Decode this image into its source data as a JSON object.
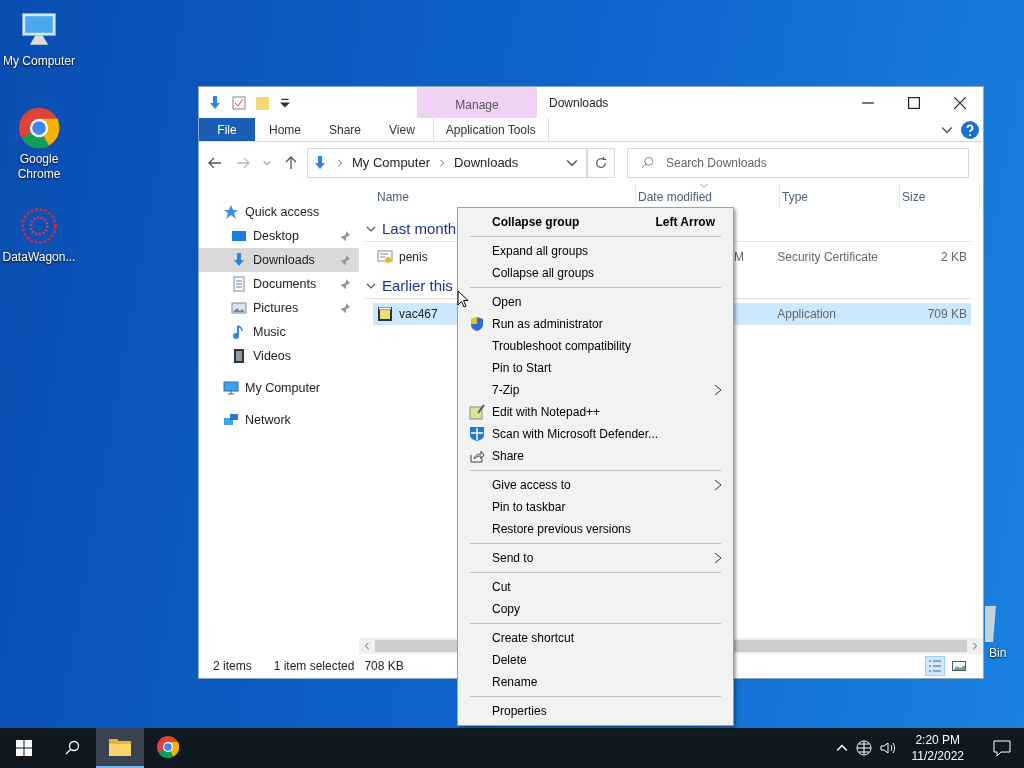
{
  "desktop_icons": [
    {
      "label": "My Computer",
      "kind": "computer"
    },
    {
      "label": "Google\nChrome",
      "kind": "browser"
    },
    {
      "label": "DataWagon...",
      "kind": "app"
    }
  ],
  "recycle_bin": {
    "label": "Bin"
  },
  "window": {
    "title": "Downloads",
    "context_tab": "Manage",
    "ribbon_tabs": [
      {
        "label": "File",
        "selected": false,
        "kind": "file"
      },
      {
        "label": "Home",
        "selected": false,
        "kind": "tab"
      },
      {
        "label": "Share",
        "selected": false,
        "kind": "tab"
      },
      {
        "label": "View",
        "selected": false,
        "kind": "tab"
      },
      {
        "label": "Application Tools",
        "selected": false,
        "kind": "context"
      }
    ],
    "address": {
      "crumbs": [
        "My Computer",
        "Downloads"
      ]
    },
    "search": {
      "placeholder": "Search Downloads"
    },
    "nav": [
      {
        "label": "Quick access",
        "kind": "star",
        "selected": false,
        "children": [
          {
            "label": "Desktop",
            "kind": "desktop",
            "selected": false,
            "pinned": true
          },
          {
            "label": "Downloads",
            "kind": "downloads",
            "selected": true,
            "pinned": true
          },
          {
            "label": "Documents",
            "kind": "documents",
            "selected": false,
            "pinned": true
          },
          {
            "label": "Pictures",
            "kind": "pictures",
            "selected": false,
            "pinned": true
          },
          {
            "label": "Music",
            "kind": "music",
            "selected": false,
            "pinned": false
          },
          {
            "label": "Videos",
            "kind": "videos",
            "selected": false,
            "pinned": false
          }
        ]
      },
      {
        "label": "My Computer",
        "kind": "computer",
        "selected": false
      },
      {
        "label": "Network",
        "kind": "network",
        "selected": false
      }
    ],
    "columns": [
      {
        "label": "Name",
        "sorted": false
      },
      {
        "label": "Date modified",
        "sorted": true
      },
      {
        "label": "Type",
        "sorted": false
      },
      {
        "label": "Size",
        "sorted": false
      }
    ],
    "groups": [
      {
        "label": "Last month",
        "expanded": true,
        "files": [
          {
            "name": "penis",
            "kind": "certificate",
            "date": "M",
            "type": "Security Certificate",
            "size": "2 KB",
            "selected": false
          }
        ]
      },
      {
        "label": "Earlier this",
        "expanded": true,
        "files": [
          {
            "name": "vac467",
            "kind": "application",
            "type": "Application",
            "size": "709 KB",
            "selected": true
          }
        ]
      }
    ],
    "status_bar": {
      "count": "2 items",
      "selection": "1 item selected",
      "size": "708 KB"
    },
    "views": [
      {
        "kind": "details",
        "selected": true
      },
      {
        "kind": "large",
        "selected": false
      }
    ]
  },
  "context_menu": {
    "groups": [
      [
        {
          "label": "Collapse group",
          "shortcut": "Left Arrow",
          "default": true
        }
      ],
      [
        {
          "label": "Expand all groups"
        },
        {
          "label": "Collapse all groups"
        }
      ],
      [
        {
          "label": "Open"
        },
        {
          "label": "Run as administrator"
        },
        {
          "label": "Troubleshoot compatibility"
        },
        {
          "label": "Pin to Start"
        },
        {
          "label": "7-Zip",
          "submenu": true
        },
        {
          "label": "Edit with Notepad++"
        },
        {
          "label": "Scan with Microsoft Defender..."
        },
        {
          "label": "Share"
        }
      ],
      [
        {
          "label": "Give access to",
          "submenu": true
        },
        {
          "label": "Pin to taskbar"
        },
        {
          "label": "Restore previous versions"
        }
      ],
      [
        {
          "label": "Send to",
          "submenu": true
        }
      ],
      [
        {
          "label": "Cut"
        },
        {
          "label": "Copy"
        }
      ],
      [
        {
          "label": "Create shortcut"
        },
        {
          "label": "Delete"
        },
        {
          "label": "Rename"
        }
      ],
      [
        {
          "label": "Properties"
        }
      ]
    ]
  },
  "taskbar": {
    "apps": [
      {
        "kind": "folder",
        "active": true
      },
      {
        "kind": "browser",
        "active": false
      }
    ],
    "time": "2:20 PM",
    "date": "11/2/2022"
  }
}
